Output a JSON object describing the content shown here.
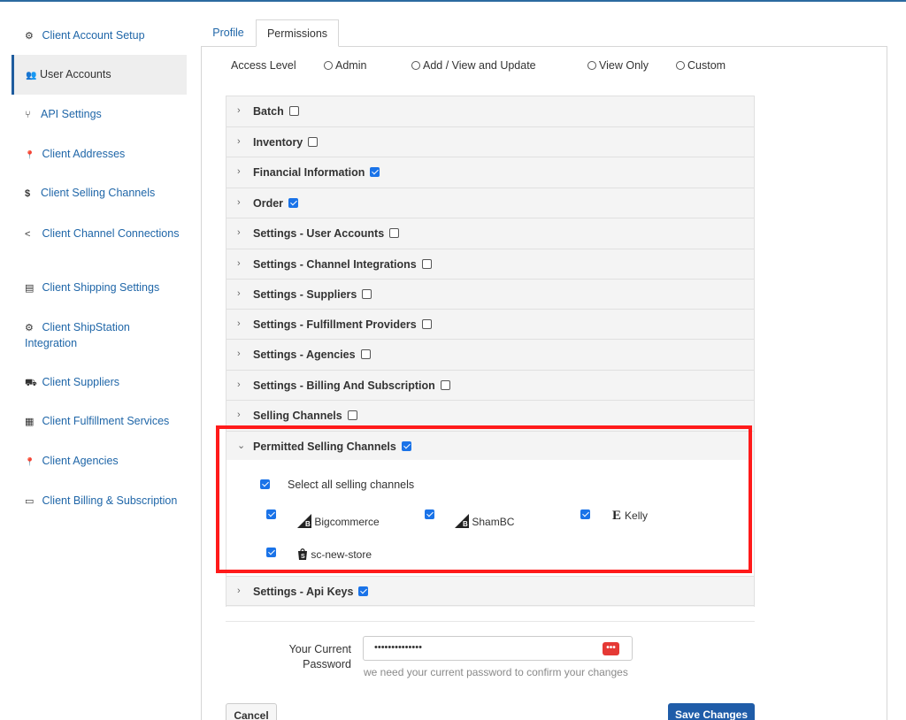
{
  "sidebar": {
    "items": [
      {
        "label": "Client Account Setup",
        "icon": "gear-icon",
        "glyph": "⚙"
      },
      {
        "label": "User Accounts",
        "icon": "users-icon",
        "glyph": "👥"
      },
      {
        "label": "API Settings",
        "icon": "fork-icon",
        "glyph": "⑂"
      },
      {
        "label": "Client Addresses",
        "icon": "map-pin-icon",
        "glyph": "📍"
      },
      {
        "label": "Client Selling Channels",
        "icon": "dollar-icon",
        "glyph": "$"
      },
      {
        "label": "Client Channel Connections",
        "icon": "share-icon",
        "glyph": "<"
      },
      {
        "label": "Client Shipping Settings",
        "icon": "document-icon",
        "glyph": "▤"
      },
      {
        "label": "Client ShipStation Integration",
        "icon": "gear-icon",
        "glyph": "⚙"
      },
      {
        "label": "Client Suppliers",
        "icon": "truck-icon",
        "glyph": "⛟"
      },
      {
        "label": "Client Fulfillment Services",
        "icon": "building-icon",
        "glyph": "▦"
      },
      {
        "label": "Client Agencies",
        "icon": "map-pin-icon",
        "glyph": "📍"
      },
      {
        "label": "Client Billing & Subscription",
        "icon": "credit-card-icon",
        "glyph": "▭"
      }
    ]
  },
  "tabs": {
    "profile": "Profile",
    "permissions": "Permissions"
  },
  "access_level": {
    "label": "Access Level",
    "options": [
      "Admin",
      "Add / View and Update",
      "View Only",
      "Custom"
    ]
  },
  "permissions": {
    "batch": {
      "label": "Batch",
      "checked": false
    },
    "inventory": {
      "label": "Inventory",
      "checked": false
    },
    "financial": {
      "label": "Financial Information",
      "checked": true
    },
    "order": {
      "label": "Order",
      "checked": true
    },
    "user_accounts": {
      "label": "Settings - User Accounts",
      "checked": false
    },
    "channel_integrations": {
      "label": "Settings - Channel Integrations",
      "checked": false
    },
    "suppliers": {
      "label": "Settings - Suppliers",
      "checked": false
    },
    "fulfillment": {
      "label": "Settings - Fulfillment Providers",
      "checked": false
    },
    "agencies": {
      "label": "Settings - Agencies",
      "checked": false
    },
    "billing": {
      "label": "Settings - Billing And Subscription",
      "checked": false
    },
    "selling_channels": {
      "label": "Selling Channels",
      "checked": false
    },
    "permitted_selling_channels": {
      "label": "Permitted Selling Channels",
      "checked": true
    },
    "api_keys": {
      "label": "Settings - Api Keys",
      "checked": true
    }
  },
  "permitted_channels": {
    "select_all": "Select all selling channels",
    "channels": [
      {
        "name": "Bigcommerce",
        "logo": "bigcommerce-icon",
        "checked": true
      },
      {
        "name": "ShamBC",
        "logo": "bigcommerce-icon",
        "checked": true
      },
      {
        "name": "Kelly",
        "logo": "etsy-icon",
        "glyph": "E",
        "checked": true
      },
      {
        "name": "sc-new-store",
        "logo": "shopify-icon",
        "checked": true
      }
    ]
  },
  "password": {
    "label": "Your Current Password",
    "value": "••••••••••••••",
    "help": "we need your current password to confirm your changes",
    "icon_glyph": "•••"
  },
  "buttons": {
    "cancel": "Cancel",
    "save": "Save Changes"
  },
  "colors": {
    "accent": "#1f5ca8",
    "highlight": "#ff1a1a",
    "checkbox": "#1a73e8"
  }
}
